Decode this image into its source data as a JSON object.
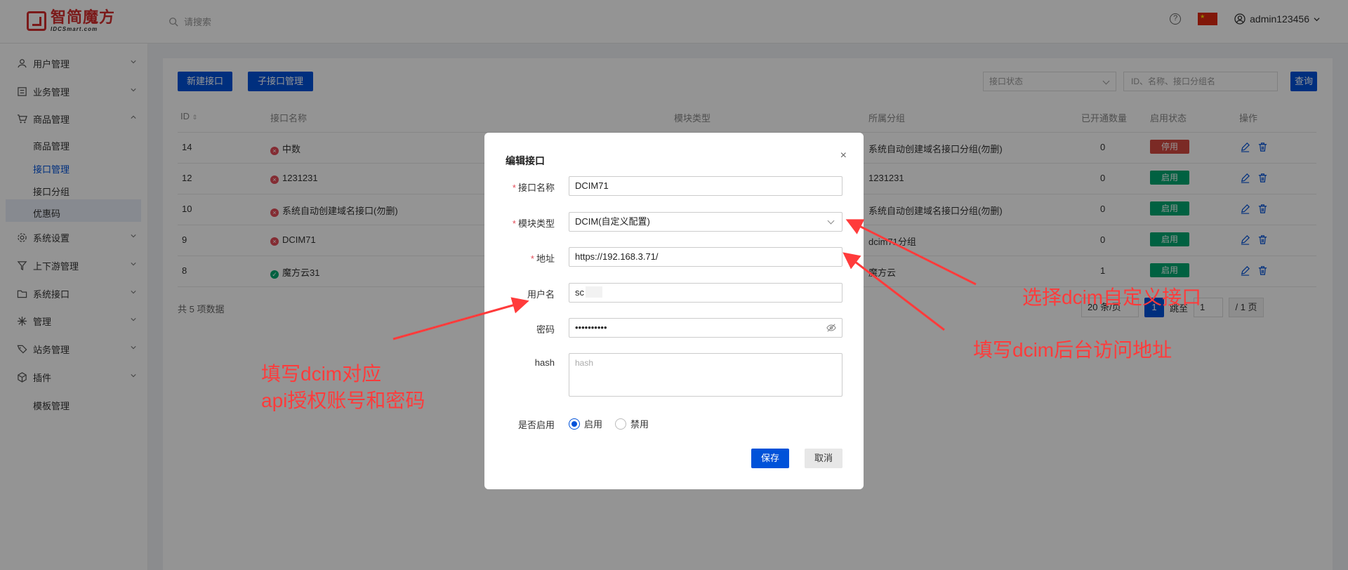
{
  "header": {
    "logo_cn": "智简魔方",
    "logo_en": "IDCSmart.com",
    "search_placeholder": "请搜索",
    "username": "admin123456"
  },
  "sidebar": {
    "items": [
      {
        "label": "用户管理"
      },
      {
        "label": "业务管理"
      },
      {
        "label": "商品管理"
      },
      {
        "label": "系统设置"
      },
      {
        "label": "上下游管理"
      },
      {
        "label": "系统接口"
      },
      {
        "label": "管理"
      },
      {
        "label": "站务管理"
      },
      {
        "label": "插件"
      }
    ],
    "sub_items": [
      "商品管理",
      "接口管理",
      "接口分组",
      "优惠码"
    ],
    "plugin_sub": "模板管理"
  },
  "toolbar": {
    "new_button": "新建接口",
    "sub_button": "子接口管理",
    "status_select": "接口状态",
    "search_placeholder": "ID、名称、接口分组名",
    "query_button": "查询"
  },
  "table": {
    "headers": [
      "ID",
      "接口名称",
      "模块类型",
      "所属分组",
      "已开通数量",
      "启用状态",
      "操作"
    ],
    "rows": [
      {
        "id": "14",
        "name": "中数",
        "group": "系统自动创建域名接口分组(勿删)",
        "count": "0",
        "status": "停用"
      },
      {
        "id": "12",
        "name": "1231231",
        "group": "1231231",
        "count": "0",
        "status": "启用"
      },
      {
        "id": "10",
        "name": "系统自动创建域名接口(勿删)",
        "group": "系统自动创建域名接口分组(勿删)",
        "count": "0",
        "status": "启用"
      },
      {
        "id": "9",
        "name": "DCIM71",
        "group": "dcim71分组",
        "count": "0",
        "status": "启用"
      },
      {
        "id": "8",
        "name": "魔方云31",
        "group": "魔方云",
        "count": "1",
        "status": "启用"
      }
    ],
    "total": "共 5 项数据"
  },
  "pagination": {
    "page_size": "20 条/页",
    "current": "1",
    "jump_label": "跳至",
    "jump_value": "1",
    "total_pages": "/ 1 页"
  },
  "modal": {
    "title": "编辑接口",
    "close": "×",
    "fields": {
      "name_label": "接口名称",
      "name_value": "DCIM71",
      "module_label": "模块类型",
      "module_value": "DCIM(自定义配置)",
      "address_label": "地址",
      "address_value": "https://192.168.3.71/",
      "username_label": "用户名",
      "username_value": "sc",
      "password_label": "密码",
      "password_value": "••••••••••",
      "hash_label": "hash",
      "hash_placeholder": "hash",
      "enable_label": "是否启用",
      "enable_on": "启用",
      "enable_off": "禁用"
    },
    "save": "保存",
    "cancel": "取消"
  },
  "annotations": {
    "account_line1": "填写dcim对应",
    "account_line2": "api授权账号和密码",
    "select_custom": "选择dcim自定义接口",
    "backend_address": "填写dcim后台访问地址"
  },
  "colors": {
    "primary": "#0052d9",
    "danger": "#d54941",
    "success": "#00a870",
    "annotation": "#ff3b3b"
  }
}
